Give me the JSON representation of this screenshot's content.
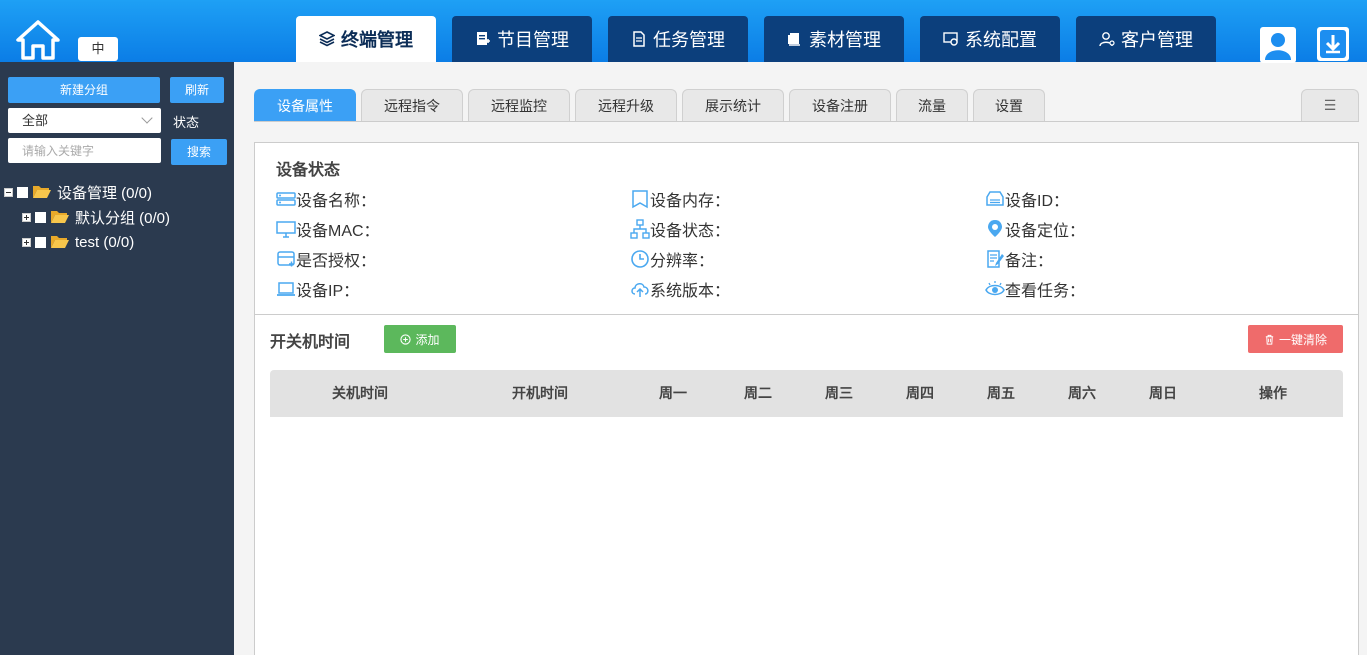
{
  "header": {
    "lang_label": "中",
    "nav_tabs": [
      {
        "label": "终端管理",
        "icon": "layers-icon",
        "active": true
      },
      {
        "label": "节目管理",
        "icon": "program-icon",
        "active": false
      },
      {
        "label": "任务管理",
        "icon": "task-icon",
        "active": false
      },
      {
        "label": "素材管理",
        "icon": "material-icon",
        "active": false
      },
      {
        "label": "系统配置",
        "icon": "system-config-icon",
        "active": false
      },
      {
        "label": "客户管理",
        "icon": "customer-icon",
        "active": false
      }
    ]
  },
  "sidebar": {
    "new_group_label": "新建分组",
    "refresh_label": "刷新",
    "select_value": "全部",
    "status_label": "状态",
    "search_placeholder": "请输入关键字",
    "search_label": "搜索",
    "tree": [
      {
        "label": "设备管理 (0/0)",
        "level": 0,
        "expanded": true
      },
      {
        "label": "默认分组 (0/0)",
        "level": 1,
        "expanded": false
      },
      {
        "label": "test (0/0)",
        "level": 1,
        "expanded": false
      }
    ]
  },
  "sub_tabs": [
    {
      "label": "设备属性",
      "active": true
    },
    {
      "label": "远程指令",
      "active": false
    },
    {
      "label": "远程监控",
      "active": false
    },
    {
      "label": "远程升级",
      "active": false
    },
    {
      "label": "展示统计",
      "active": false
    },
    {
      "label": "设备注册",
      "active": false
    },
    {
      "label": "流量",
      "active": false
    },
    {
      "label": "设置",
      "active": false
    }
  ],
  "menu_tab_label": "☰",
  "device_status": {
    "title": "设备状态",
    "props": [
      {
        "label": "设备名称：",
        "icon": "server-icon"
      },
      {
        "label": "设备内存：",
        "icon": "memory-icon"
      },
      {
        "label": "设备ID：",
        "icon": "device-id-icon"
      },
      {
        "label": "设备MAC：",
        "icon": "monitor-icon"
      },
      {
        "label": "设备状态：",
        "icon": "network-icon"
      },
      {
        "label": "设备定位：",
        "icon": "location-icon"
      },
      {
        "label": "是否授权：",
        "icon": "authorize-icon"
      },
      {
        "label": "分辨率：",
        "icon": "clock-icon"
      },
      {
        "label": "备注：",
        "icon": "note-icon"
      },
      {
        "label": "设备IP：",
        "icon": "laptop-icon"
      },
      {
        "label": "系统版本：",
        "icon": "cloud-upload-icon"
      },
      {
        "label": "查看任务：",
        "icon": "eye-icon"
      }
    ]
  },
  "power_schedule": {
    "title": "开关机时间",
    "add_label": "添加",
    "clear_label": "一键清除",
    "columns": [
      "关机时间",
      "开机时间",
      "周一",
      "周二",
      "周三",
      "周四",
      "周五",
      "周六",
      "周日",
      "操作"
    ]
  },
  "colors": {
    "header_blue": "#0b7de6",
    "nav_dark": "#0c3f7c",
    "sidebar_bg": "#2b3a4f",
    "accent_blue": "#3ba0f5",
    "add_green": "#5cb85c",
    "clear_red": "#ef6b6b"
  }
}
